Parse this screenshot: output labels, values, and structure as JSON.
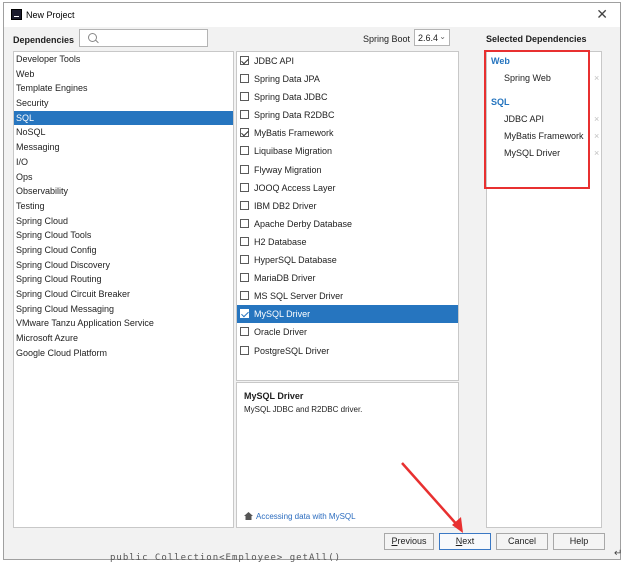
{
  "window": {
    "title": "New Project",
    "close_glyph": "✕"
  },
  "dependencies_label": "Dependencies",
  "search": {
    "placeholder": "",
    "value": ""
  },
  "spring_boot": {
    "label": "Spring Boot",
    "version": "2.6.4"
  },
  "categories": [
    {
      "label": "Developer Tools",
      "selected": false
    },
    {
      "label": "Web",
      "selected": false
    },
    {
      "label": "Template Engines",
      "selected": false
    },
    {
      "label": "Security",
      "selected": false
    },
    {
      "label": "SQL",
      "selected": true
    },
    {
      "label": "NoSQL",
      "selected": false
    },
    {
      "label": "Messaging",
      "selected": false
    },
    {
      "label": "I/O",
      "selected": false
    },
    {
      "label": "Ops",
      "selected": false
    },
    {
      "label": "Observability",
      "selected": false
    },
    {
      "label": "Testing",
      "selected": false
    },
    {
      "label": "Spring Cloud",
      "selected": false
    },
    {
      "label": "Spring Cloud Tools",
      "selected": false
    },
    {
      "label": "Spring Cloud Config",
      "selected": false
    },
    {
      "label": "Spring Cloud Discovery",
      "selected": false
    },
    {
      "label": "Spring Cloud Routing",
      "selected": false
    },
    {
      "label": "Spring Cloud Circuit Breaker",
      "selected": false
    },
    {
      "label": "Spring Cloud Messaging",
      "selected": false
    },
    {
      "label": "VMware Tanzu Application Service",
      "selected": false
    },
    {
      "label": "Microsoft Azure",
      "selected": false
    },
    {
      "label": "Google Cloud Platform",
      "selected": false
    }
  ],
  "dependencies": [
    {
      "label": "JDBC API",
      "checked": true,
      "selected": false
    },
    {
      "label": "Spring Data JPA",
      "checked": false,
      "selected": false
    },
    {
      "label": "Spring Data JDBC",
      "checked": false,
      "selected": false
    },
    {
      "label": "Spring Data R2DBC",
      "checked": false,
      "selected": false
    },
    {
      "label": "MyBatis Framework",
      "checked": true,
      "selected": false
    },
    {
      "label": "Liquibase Migration",
      "checked": false,
      "selected": false
    },
    {
      "label": "Flyway Migration",
      "checked": false,
      "selected": false
    },
    {
      "label": "JOOQ Access Layer",
      "checked": false,
      "selected": false
    },
    {
      "label": "IBM DB2 Driver",
      "checked": false,
      "selected": false
    },
    {
      "label": "Apache Derby Database",
      "checked": false,
      "selected": false
    },
    {
      "label": "H2 Database",
      "checked": false,
      "selected": false
    },
    {
      "label": "HyperSQL Database",
      "checked": false,
      "selected": false
    },
    {
      "label": "MariaDB Driver",
      "checked": false,
      "selected": false
    },
    {
      "label": "MS SQL Server Driver",
      "checked": false,
      "selected": false
    },
    {
      "label": "MySQL Driver",
      "checked": true,
      "selected": true
    },
    {
      "label": "Oracle Driver",
      "checked": false,
      "selected": false
    },
    {
      "label": "PostgreSQL Driver",
      "checked": false,
      "selected": false
    }
  ],
  "description": {
    "title": "MySQL Driver",
    "text": "MySQL JDBC and R2DBC driver.",
    "link": "Accessing data with MySQL"
  },
  "selected_dependencies": {
    "label": "Selected Dependencies",
    "remove_glyph": "×",
    "groups": [
      {
        "name": "Web",
        "items": [
          "Spring Web"
        ]
      },
      {
        "name": "SQL",
        "items": [
          "JDBC API",
          "MyBatis Framework",
          "MySQL Driver"
        ]
      }
    ]
  },
  "buttons": {
    "previous": {
      "mnemonic": "P",
      "rest": "revious"
    },
    "next": {
      "mnemonic": "N",
      "rest": "ext"
    },
    "cancel": "Cancel",
    "help": "Help"
  },
  "background_code": "public Collection<Employee> getAll()",
  "return_mark": "↵",
  "colors": {
    "selection": "#2675bf",
    "group_header": "#2675bf",
    "annotation": "#e83030",
    "link": "#2b6cbf"
  }
}
